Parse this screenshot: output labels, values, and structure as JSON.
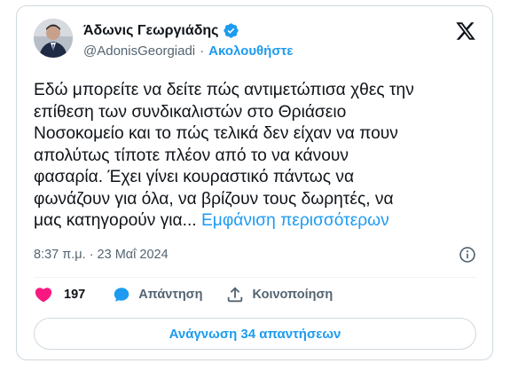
{
  "author": {
    "name": "Άδωνις Γεωργιάδης",
    "handle": "@AdonisGeorgiadi",
    "separator": "·",
    "follow_label": "Ακολουθήστε",
    "verified_icon": "verified-badge-icon"
  },
  "tweet": {
    "lines": [
      "Εδώ μπορείτε να δείτε πώς αντιμετώπισα χθες την",
      "επίθεση των συνδικαλιστών στο Θριάσειο",
      "Νοσοκομείο και το πώς τελικά δεν είχαν να πουν",
      "απολύτως τίποτε πλέον από το να κάνουν",
      "φασαρία. Έχει γίνει κουραστικό πάντως να",
      "φωνάζουν για όλα, να βρίζουν τους δωρητές, να",
      "μας κατηγορούν για..."
    ],
    "show_more": "Εμφάνιση περισσότερων",
    "timestamp": "8:37 π.μ. · 23 Μαΐ 2024"
  },
  "actions": {
    "like_count": "197",
    "reply_label": "Απάντηση",
    "share_label": "Κοινοποίηση"
  },
  "read_replies_label": "Ανάγνωση 34 απαντήσεων",
  "colors": {
    "accent": "#1d9bf0",
    "like": "#f91880",
    "text": "#0f1419",
    "muted": "#536471",
    "border": "#cfd9de"
  }
}
